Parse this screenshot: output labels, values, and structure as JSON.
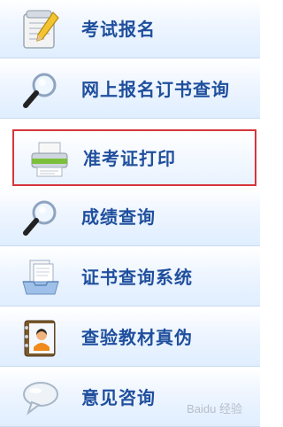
{
  "menu": {
    "items": [
      {
        "label": "考试报名",
        "icon": "notepad-pencil-icon"
      },
      {
        "label": "网上报名订书查询",
        "icon": "magnifier-icon"
      },
      {
        "label": "准考证打印",
        "icon": "printer-icon",
        "selected": true
      },
      {
        "label": "成绩查询",
        "icon": "magnifier-icon"
      },
      {
        "label": "证书查询系统",
        "icon": "document-tray-icon"
      },
      {
        "label": "查验教材真伪",
        "icon": "contact-book-icon"
      },
      {
        "label": "意见咨询",
        "icon": "chat-bubble-icon"
      }
    ]
  },
  "watermark": "Baidu 经验"
}
